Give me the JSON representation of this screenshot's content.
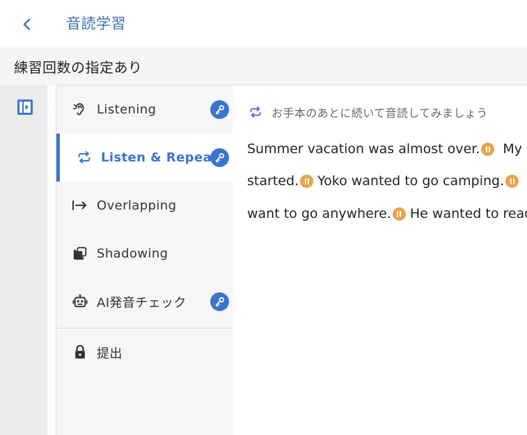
{
  "header": {
    "back_icon": "chevron-left-icon",
    "title": "音読学習"
  },
  "section": {
    "title": "練習回数の指定あり"
  },
  "sidebar_toggle_icon": "panel-toggle-icon",
  "menu": {
    "items": [
      {
        "label": "Listening",
        "icon": "ear-icon",
        "badge": "key-icon",
        "active": false
      },
      {
        "label": "Listen & Repeat",
        "icon": "repeat-icon",
        "badge": "key-icon",
        "active": true
      },
      {
        "label": "Overlapping",
        "icon": "arrow-right-to-bar-icon",
        "active": false
      },
      {
        "label": "Shadowing",
        "icon": "copy-icon",
        "active": false
      },
      {
        "label": "AI発音チェック",
        "icon": "robot-icon",
        "badge": "key-icon",
        "active": false
      },
      {
        "label": "提出",
        "icon": "lock-icon",
        "active": false
      }
    ]
  },
  "content": {
    "instruction": "お手本のあとに続いて音読してみましょう",
    "lines": [
      [
        "Summer vacation was almost over.",
        "My"
      ],
      [
        "started.",
        "Yoko wanted to go camping."
      ],
      [
        "want to go anywhere.",
        "He wanted to read"
      ]
    ]
  },
  "colors": {
    "accent": "#3a74d0",
    "title": "#3f6fb5",
    "pause": "#e9a34a"
  }
}
